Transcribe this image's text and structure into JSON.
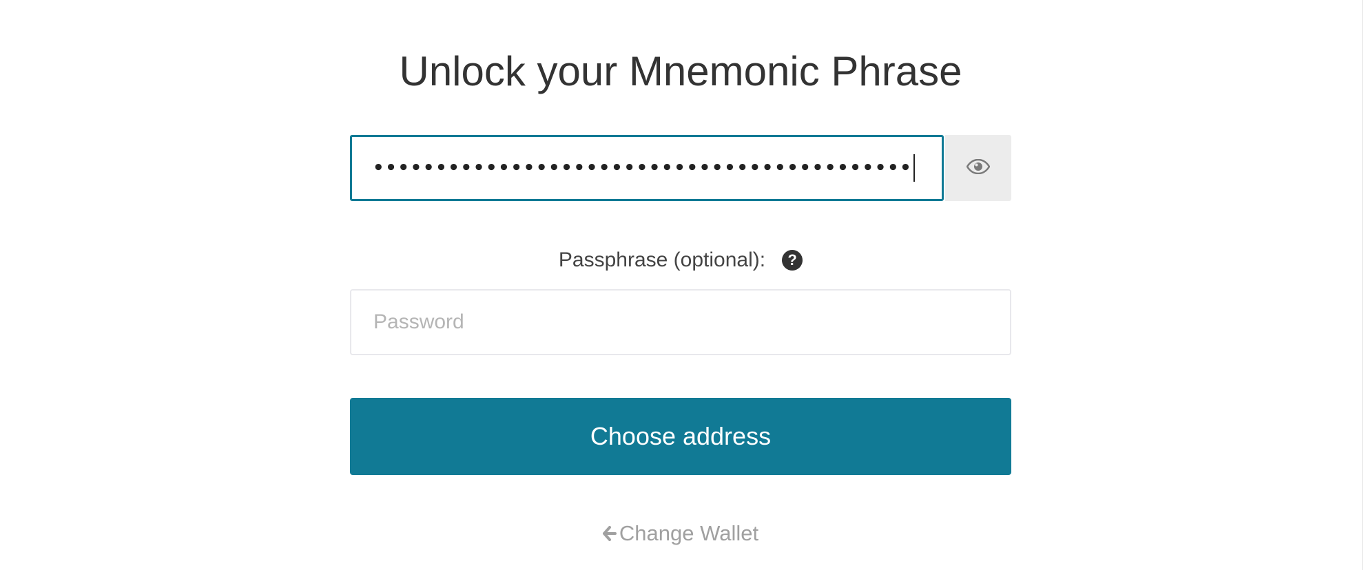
{
  "page": {
    "title": "Unlock your Mnemonic Phrase"
  },
  "mnemonic": {
    "masked_value": "•••••••••••••••••••••••••••••••••••••••••••",
    "toggle_icon": "eye-icon"
  },
  "passphrase": {
    "label": "Passphrase (optional):",
    "help_icon": "question-circle-icon",
    "help_glyph": "?",
    "placeholder": "Password",
    "value": ""
  },
  "actions": {
    "choose_address_label": "Choose address",
    "change_wallet_label": "Change Wallet",
    "change_wallet_icon": "arrow-left-icon"
  },
  "colors": {
    "accent": "#117a95",
    "text": "#333333",
    "muted": "#a0a0a0",
    "toggle_bg": "#ececec"
  }
}
